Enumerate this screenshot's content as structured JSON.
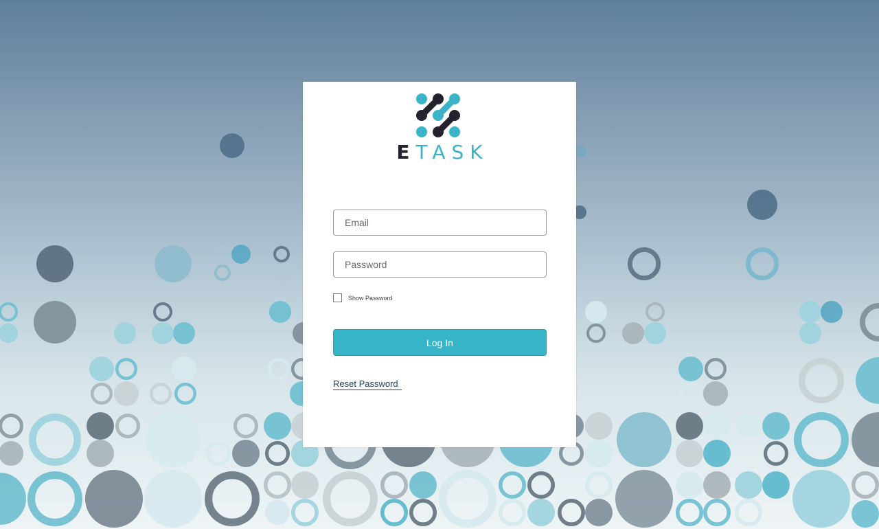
{
  "brand": {
    "logo_icon": "etask-molecule-logo-icon",
    "first_letter": "E",
    "rest": "TASK",
    "colors": {
      "dark": "#23232f",
      "accent": "#3ab3c9"
    }
  },
  "form": {
    "email_placeholder": "Email",
    "email_value": "",
    "password_placeholder": "Password",
    "password_value": "",
    "show_password_label": "Show Password",
    "show_password_checked": false,
    "login_label": "Log In",
    "reset_label": "Reset Password"
  },
  "colors": {
    "button": "#36b5c8",
    "link": "#1e3a5a"
  }
}
